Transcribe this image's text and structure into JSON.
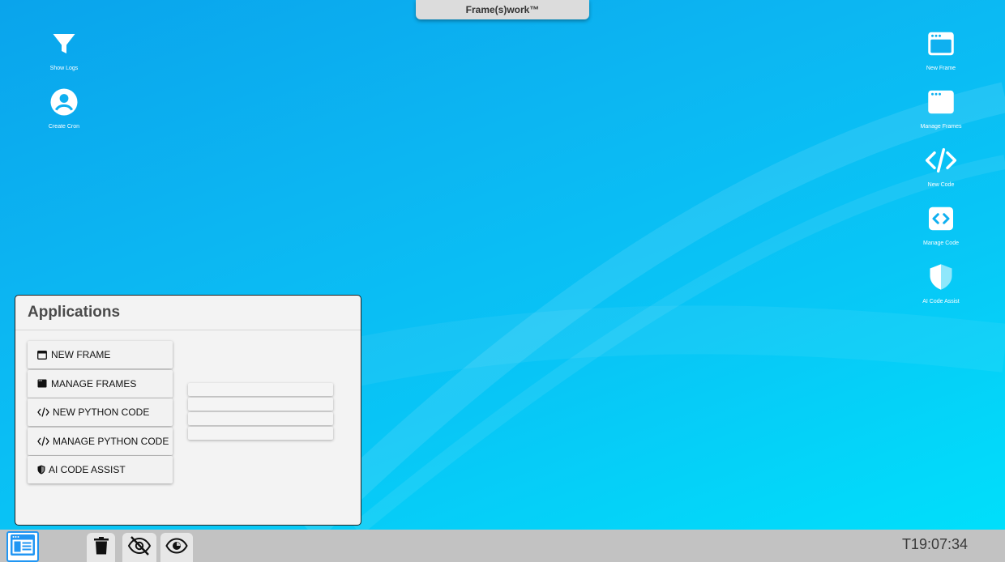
{
  "top_title": "Frame(s)work™",
  "desktop_left": [
    {
      "label": "Show Logs",
      "icon": "filter-icon"
    },
    {
      "label": "Create Cron",
      "icon": "account-circle-icon"
    }
  ],
  "desktop_right": [
    {
      "label": "New Frame",
      "icon": "window-icon"
    },
    {
      "label": "Manage Frames",
      "icon": "window-icon"
    },
    {
      "label": "New Code",
      "icon": "code-icon"
    },
    {
      "label": "Manage Code",
      "icon": "code-box-icon"
    },
    {
      "label": "AI Code Assist",
      "icon": "shield-icon"
    }
  ],
  "app_window": {
    "title": "Applications",
    "items": [
      {
        "label": "NEW FRAME",
        "icon": "window-outline-icon"
      },
      {
        "label": "MANAGE FRAMES",
        "icon": "window-filled-icon"
      },
      {
        "label": "NEW PYTHON CODE",
        "icon": "code-icon"
      },
      {
        "label": "MANAGE PYTHON CODE",
        "icon": "code-icon"
      },
      {
        "label": "AI CODE ASSIST",
        "icon": "shield-half-icon"
      }
    ]
  },
  "taskbar": {
    "clock": "T19:07:34",
    "buttons": [
      "start-menu-icon",
      "trash-icon",
      "eye-off-icon",
      "eye-icon"
    ]
  },
  "colors": {
    "desktop_gradient_start": "#0aa4ec",
    "desktop_gradient_end": "#00dffb",
    "taskbar": "#c2c2c2",
    "start_button": "#2196f3"
  }
}
